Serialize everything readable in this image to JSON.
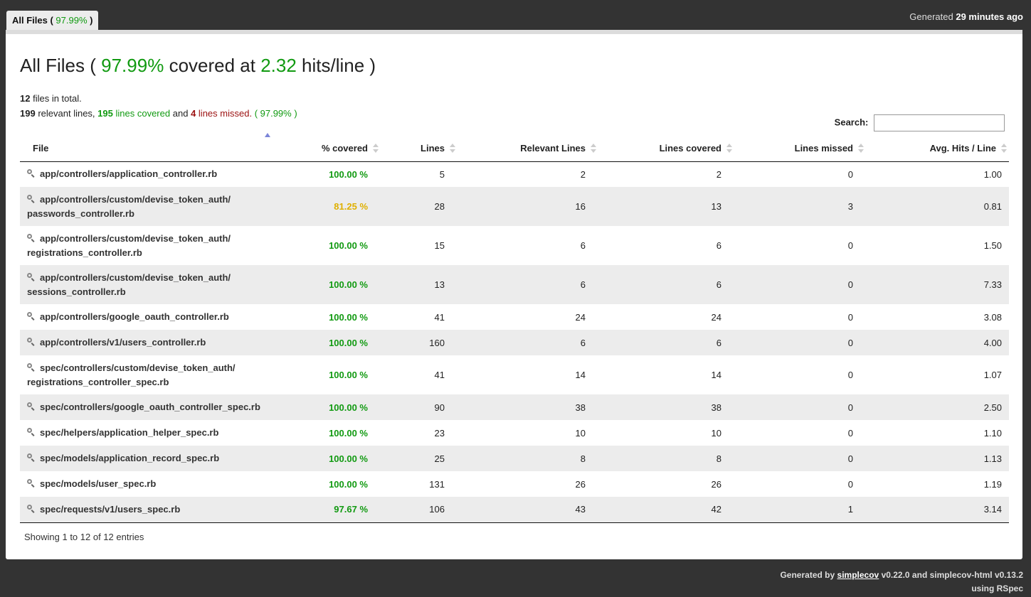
{
  "tab": {
    "label": "All Files (",
    "pct": "97.99%",
    "close": ")"
  },
  "generated": {
    "prefix": "Generated",
    "time": "29 minutes ago"
  },
  "title": {
    "prefix": "All Files (",
    "coverage": "97.99%",
    "mid": "covered at",
    "hits": "2.32",
    "suffix": "hits/line )"
  },
  "summary": {
    "files_count": "12",
    "files_text": "files in total.",
    "relevant": "199",
    "relevant_text": "relevant lines,",
    "covered": "195",
    "covered_text": "lines covered",
    "and": "and",
    "missed": "4",
    "missed_text": "lines missed.",
    "pct_text": "( 97.99% )"
  },
  "search": {
    "label": "Search:",
    "value": ""
  },
  "columns": [
    "File",
    "% covered",
    "Lines",
    "Relevant Lines",
    "Lines covered",
    "Lines missed",
    "Avg. Hits / Line"
  ],
  "rows": [
    {
      "file": "app/controllers/application_controller.rb",
      "file2": "",
      "pct": "100.00 %",
      "level": "green",
      "lines": "5",
      "relevant": "2",
      "covered": "2",
      "missed": "0",
      "avg": "1.00"
    },
    {
      "file": "app/controllers/custom/devise_token_auth/",
      "file2": "passwords_controller.rb",
      "pct": "81.25 %",
      "level": "yellow",
      "lines": "28",
      "relevant": "16",
      "covered": "13",
      "missed": "3",
      "avg": "0.81"
    },
    {
      "file": "app/controllers/custom/devise_token_auth/",
      "file2": "registrations_controller.rb",
      "pct": "100.00 %",
      "level": "green",
      "lines": "15",
      "relevant": "6",
      "covered": "6",
      "missed": "0",
      "avg": "1.50"
    },
    {
      "file": "app/controllers/custom/devise_token_auth/",
      "file2": "sessions_controller.rb",
      "pct": "100.00 %",
      "level": "green",
      "lines": "13",
      "relevant": "6",
      "covered": "6",
      "missed": "0",
      "avg": "7.33"
    },
    {
      "file": "app/controllers/google_oauth_controller.rb",
      "file2": "",
      "pct": "100.00 %",
      "level": "green",
      "lines": "41",
      "relevant": "24",
      "covered": "24",
      "missed": "0",
      "avg": "3.08"
    },
    {
      "file": "app/controllers/v1/users_controller.rb",
      "file2": "",
      "pct": "100.00 %",
      "level": "green",
      "lines": "160",
      "relevant": "6",
      "covered": "6",
      "missed": "0",
      "avg": "4.00"
    },
    {
      "file": "spec/controllers/custom/devise_token_auth/",
      "file2": "registrations_controller_spec.rb",
      "pct": "100.00 %",
      "level": "green",
      "lines": "41",
      "relevant": "14",
      "covered": "14",
      "missed": "0",
      "avg": "1.07"
    },
    {
      "file": "spec/controllers/google_oauth_controller_spec.rb",
      "file2": "",
      "pct": "100.00 %",
      "level": "green",
      "lines": "90",
      "relevant": "38",
      "covered": "38",
      "missed": "0",
      "avg": "2.50"
    },
    {
      "file": "spec/helpers/application_helper_spec.rb",
      "file2": "",
      "pct": "100.00 %",
      "level": "green",
      "lines": "23",
      "relevant": "10",
      "covered": "10",
      "missed": "0",
      "avg": "1.10"
    },
    {
      "file": "spec/models/application_record_spec.rb",
      "file2": "",
      "pct": "100.00 %",
      "level": "green",
      "lines": "25",
      "relevant": "8",
      "covered": "8",
      "missed": "0",
      "avg": "1.13"
    },
    {
      "file": "spec/models/user_spec.rb",
      "file2": "",
      "pct": "100.00 %",
      "level": "green",
      "lines": "131",
      "relevant": "26",
      "covered": "26",
      "missed": "0",
      "avg": "1.19"
    },
    {
      "file": "spec/requests/v1/users_spec.rb",
      "file2": "",
      "pct": "97.67 %",
      "level": "green",
      "lines": "106",
      "relevant": "43",
      "covered": "42",
      "missed": "1",
      "avg": "3.14"
    }
  ],
  "info": "Showing 1 to 12 of 12 entries",
  "footer": {
    "gen_by": "Generated by",
    "simplecov": "simplecov",
    "versions": "v0.22.0 and simplecov-html v0.13.2",
    "using": "using RSpec"
  },
  "colors": {
    "green": "#119a11",
    "yellow": "#dfb000",
    "red": "#9b1010",
    "background": "#333333"
  },
  "icons": {
    "file_row": "magnifier-icon",
    "sort": "sort-arrows-icon"
  }
}
